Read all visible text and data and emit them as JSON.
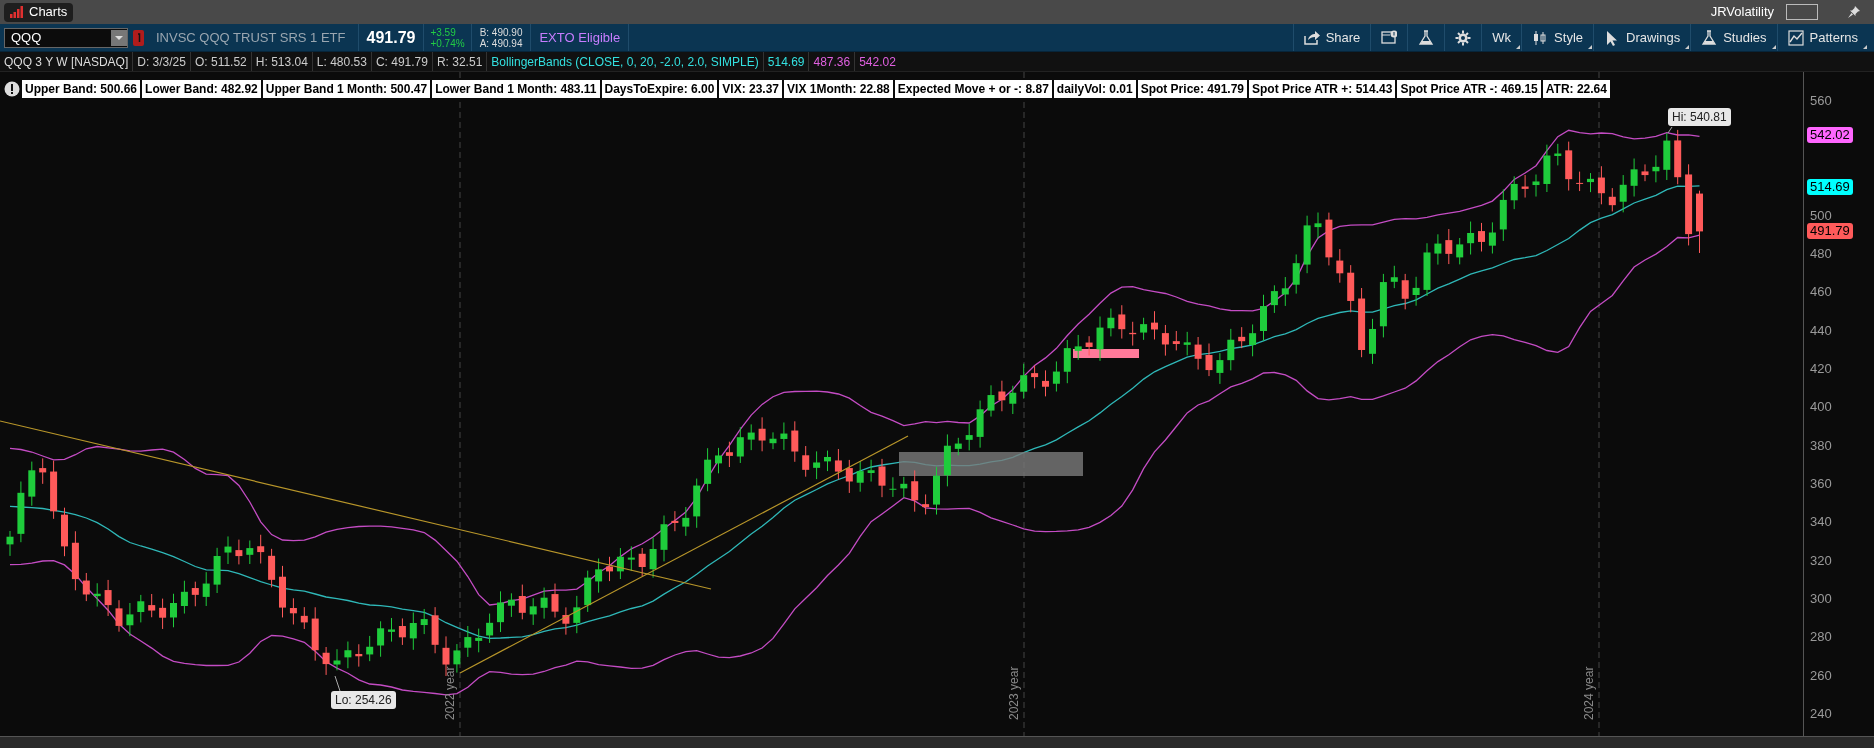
{
  "app_bar": {
    "title": "Charts",
    "account": "JRVolatility"
  },
  "toolbar": {
    "symbol": "QQQ",
    "description": "INVSC QQQ TRUST SRS 1 ETF",
    "last": "491.79",
    "change": "+3.59",
    "change_pct": "+0.74%",
    "bid": "B: 490.90",
    "ask": "A: 490.94",
    "badge": "EXTO Eligible",
    "buttons": [
      {
        "kind": "share",
        "label": "Share"
      },
      {
        "kind": "news"
      },
      {
        "kind": "flask"
      },
      {
        "kind": "gear"
      },
      {
        "kind": "plain",
        "label": "Wk"
      },
      {
        "kind": "style",
        "label": "Style"
      },
      {
        "kind": "drawings",
        "label": "Drawings"
      },
      {
        "kind": "studies",
        "label": "Studies"
      },
      {
        "kind": "patterns",
        "label": "Patterns"
      }
    ]
  },
  "chart_header": {
    "title": "QQQ 3 Y W [NASDAQ]",
    "stats": [
      "D: 3/3/25",
      "O: 511.52",
      "H: 513.04",
      "L: 480.53",
      "C: 491.79",
      "R: 32.51"
    ],
    "study": "BollingerBands (CLOSE, 0, 20, -2.0, 2.0, SIMPLE)",
    "study_values": [
      {
        "text": "514.69",
        "color": "#33e0e0"
      },
      {
        "text": "487.36",
        "color": "#e060e0"
      },
      {
        "text": "542.02",
        "color": "#e060e0"
      }
    ]
  },
  "labels": [
    "Upper Band: 500.66",
    "Lower Band: 482.92",
    "Upper Band 1 Month: 500.47",
    "Lower Band 1 Month: 483.11",
    "DaysToExpire: 6.00",
    "VIX: 23.37",
    "VIX 1Month: 22.88",
    "Expected Move + or -: 8.87",
    "dailyVol: 0.01",
    "Spot Price: 491.79",
    "Spot Price ATR +: 514.43",
    "Spot Price ATR -: 469.15",
    "ATR: 22.64"
  ],
  "chart": {
    "y_axis_labels": [
      "560",
      "500",
      "480",
      "460",
      "440",
      "420",
      "400",
      "380",
      "360",
      "340",
      "320",
      "300",
      "280",
      "260",
      "240"
    ],
    "price_badges": [
      {
        "text": "542.02",
        "color": "#ff66ff"
      },
      {
        "text": "514.69",
        "color": "#00ffff"
      },
      {
        "text": "491.79",
        "color": "#ff5a5a"
      }
    ],
    "year_labels": [
      "2022 year",
      "2023 year",
      "2024 year"
    ],
    "high_label": "Hi: 540.81",
    "low_label": "Lo: 254.26"
  }
}
